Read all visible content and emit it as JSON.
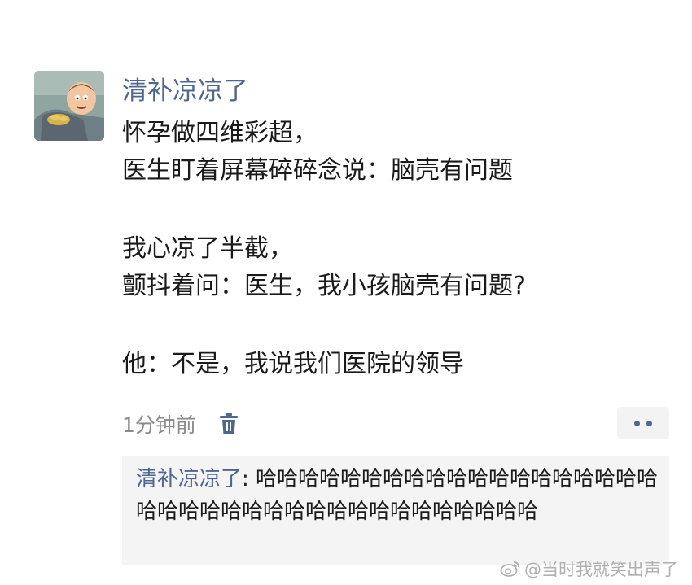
{
  "post": {
    "username": "清补凉凉了",
    "lines": [
      "怀孕做四维彩超，",
      "医生盯着屏幕碎碎念说：脑壳有问题",
      "",
      "我心凉了半截，",
      "颤抖着问：医生，我小孩脑壳有问题?",
      "",
      "他：不是，我说我们医院的领导"
    ],
    "timestamp": "1分钟前"
  },
  "comment": {
    "author": "清补凉凉了",
    "separator": ": ",
    "text": "哈哈哈哈哈哈哈哈哈哈哈哈哈哈哈哈哈哈哈哈哈哈哈哈哈哈哈哈哈哈哈哈哈哈哈哈哈哈"
  },
  "watermark": {
    "text": "@当时我就笑出声了"
  },
  "icons": {
    "avatar": "cartoon-avatar",
    "delete": "trash-icon",
    "more": "more-dots-icon",
    "watermark": "weibo-icon"
  },
  "colors": {
    "username": "#4e6690",
    "timestamp": "#8a8a8a",
    "comment_bg": "#f4f4f4"
  }
}
